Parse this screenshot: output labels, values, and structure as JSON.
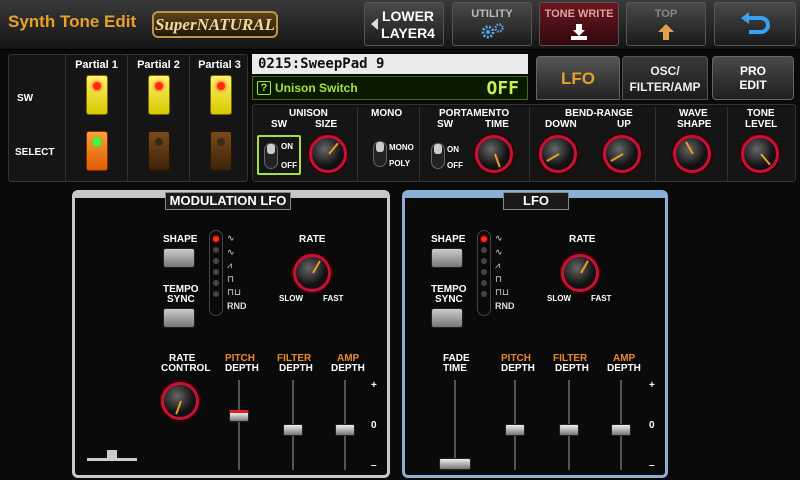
{
  "header": {
    "app_title": "Synth Tone Edit",
    "logo_text": "SuperNATURAL",
    "layer_line1": "LOWER",
    "layer_line2": "LAYER4",
    "utility_label": "UTILITY",
    "tone_write_label": "TONE WRITE",
    "top_label": "TOP"
  },
  "partials": {
    "labels": [
      "Partial 1",
      "Partial 2",
      "Partial 3"
    ],
    "sw_label": "SW",
    "select_label": "SELECT",
    "selected_index": 0
  },
  "tone": {
    "name": "0215:SweepPad 9",
    "param_name": "Unison Switch",
    "param_value": "OFF"
  },
  "tabs": {
    "lfo": "LFO",
    "osc_line1": "OSC/",
    "osc_line2": "FILTER/AMP",
    "pro_line1": "PRO",
    "pro_line2": "EDIT",
    "active": "lfo"
  },
  "params": {
    "unison": "UNISON",
    "sw": "SW",
    "size": "SIZE",
    "mono": "MONO",
    "portamento": "PORTAMENTO",
    "time": "TIME",
    "bend_range": "BEND-RANGE",
    "down": "DOWN",
    "up": "UP",
    "wave": "WAVE",
    "shape": "SHAPE",
    "tone": "TONE",
    "level": "LEVEL",
    "on": "ON",
    "off": "OFF",
    "mono_small": "MONO",
    "poly_small": "POLY"
  },
  "mod_lfo": {
    "title": "MODULATION LFO",
    "shape_label": "SHAPE",
    "tempo": "TEMPO",
    "sync": "SYNC",
    "rate_label": "RATE",
    "slow": "SLOW",
    "fast": "FAST",
    "rate": "RATE",
    "control": "CONTROL",
    "rnd": "RND",
    "pitch": "PITCH",
    "filter": "FILTER",
    "amp": "AMP",
    "depth": "DEPTH",
    "plus": "+",
    "zero": "0",
    "minus": "–"
  },
  "lfo": {
    "title": "LFO",
    "shape_label": "SHAPE",
    "tempo": "TEMPO",
    "sync": "SYNC",
    "rate_label": "RATE",
    "slow": "SLOW",
    "fast": "FAST",
    "fade": "FADE",
    "time": "TIME",
    "rnd": "RND",
    "pitch": "PITCH",
    "filter": "FILTER",
    "amp": "AMP",
    "depth": "DEPTH",
    "plus": "+",
    "zero": "0",
    "minus": "–"
  },
  "colors": {
    "accent_orange": "#e8a02a",
    "knob_ring": "#c8103a",
    "highlight_green": "#a8e040",
    "lfo_frame": "#8aaed4",
    "mod_frame": "#c8c8c8"
  }
}
